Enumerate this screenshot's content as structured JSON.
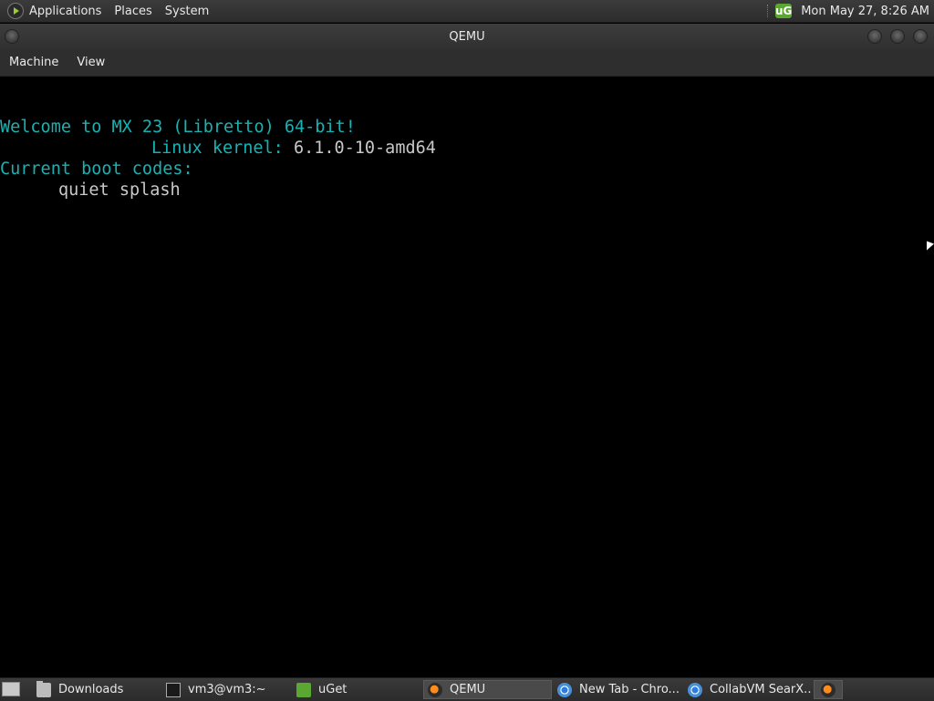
{
  "top_panel": {
    "menus": [
      "Applications",
      "Places",
      "System"
    ],
    "tray_icon": "uget-tray-icon",
    "tray_label": "uG",
    "clock": "Mon May 27,  8:26 AM"
  },
  "window": {
    "title": "QEMU",
    "menus": [
      "Machine",
      "View"
    ]
  },
  "console": {
    "lines": [
      {
        "text": "Welcome to MX 23 (Libretto) 64-bit!",
        "color": "#19b2b2"
      },
      {
        "label": "Linux kernel:",
        "value": "6.1.0-10-amd64"
      },
      {
        "text": "Current boot codes:",
        "color": "#19b2b2"
      },
      {
        "text": "quiet splash",
        "color": "#c8c8c8"
      }
    ]
  },
  "taskbar": {
    "tasks": [
      {
        "label": "Downloads",
        "icon": "folder-icon"
      },
      {
        "label": "vm3@vm3:~",
        "icon": "terminal-icon"
      },
      {
        "label": "uGet",
        "icon": "uget-icon"
      },
      {
        "label": "QEMU",
        "icon": "qemu-icon",
        "active": true
      },
      {
        "label": "New Tab - Chro...",
        "icon": "chrome-icon"
      },
      {
        "label": "CollabVM SearX...",
        "icon": "chrome-icon"
      }
    ]
  },
  "colors": {
    "console_teal": "#19b2b2",
    "console_grey": "#c8c8c8",
    "panel_bg": "#333333"
  }
}
